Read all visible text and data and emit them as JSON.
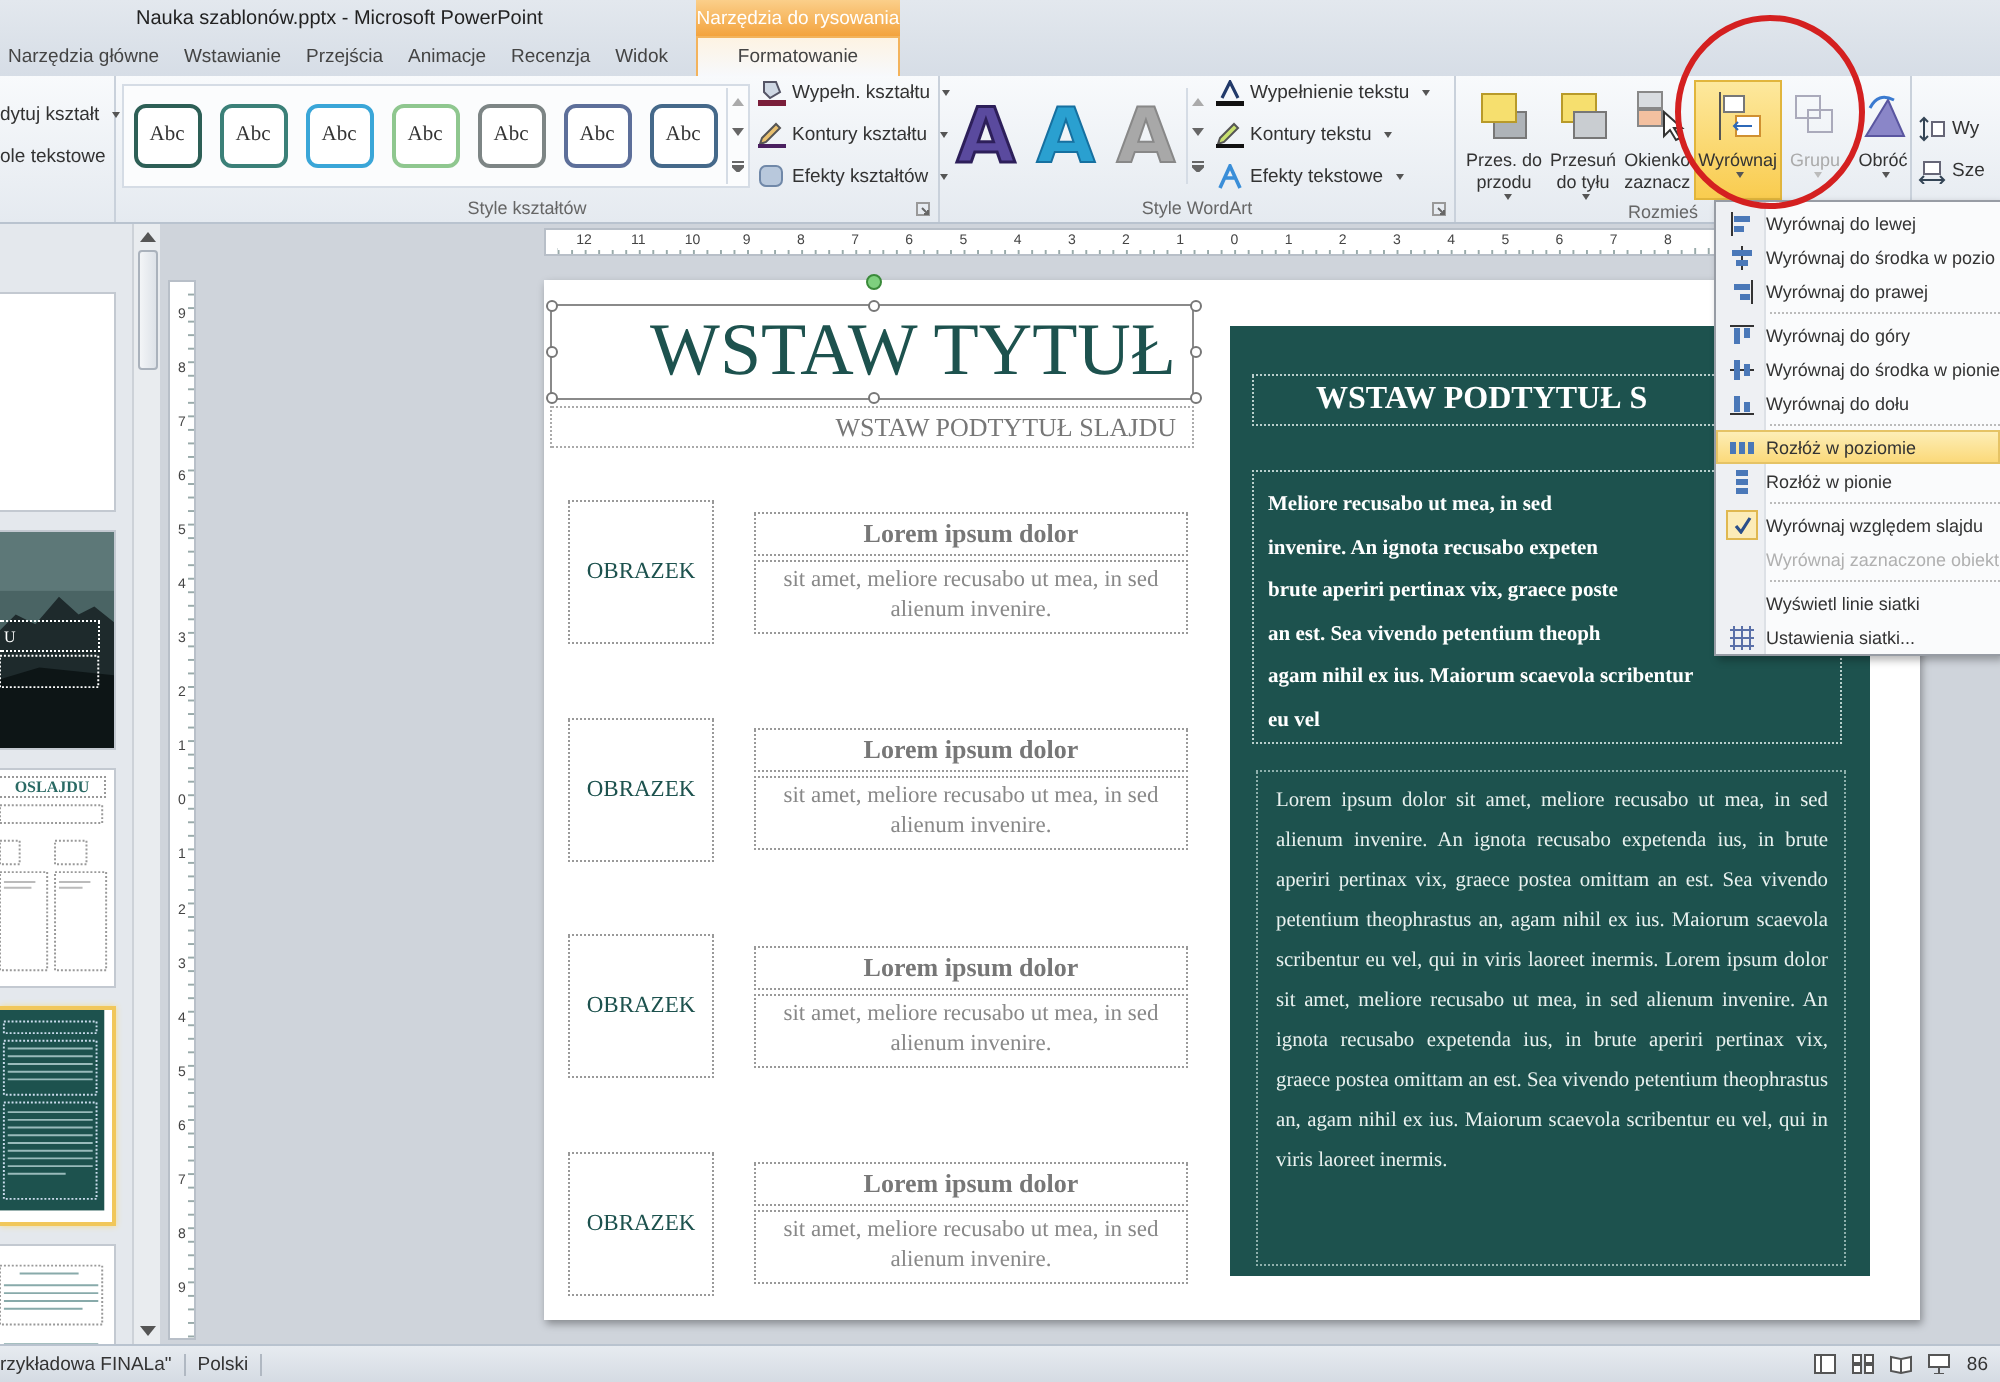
{
  "window": {
    "title": "Nauka szablonów.pptx - Microsoft PowerPoint",
    "context_label": "Narzędzia do rysowania"
  },
  "tabs": [
    {
      "label": "Narzędzia główne",
      "kind": "normal",
      "selected": false
    },
    {
      "label": "Wstawianie",
      "kind": "normal",
      "selected": false
    },
    {
      "label": "Przejścia",
      "kind": "normal",
      "selected": false
    },
    {
      "label": "Animacje",
      "kind": "normal",
      "selected": false
    },
    {
      "label": "Recenzja",
      "kind": "normal",
      "selected": false
    },
    {
      "label": "Widok",
      "kind": "normal",
      "selected": false
    },
    {
      "label": "Formatowanie",
      "kind": "context",
      "selected": true
    }
  ],
  "ribbon": {
    "edit_group": {
      "commands": [
        {
          "label": "dytuj kształt",
          "dropdown": true
        },
        {
          "label": "ole tekstowe",
          "dropdown": false
        }
      ]
    },
    "shape_styles": {
      "title": "Style kształtów",
      "swatches": [
        {
          "label": "Abc",
          "color": "#2d5f56"
        },
        {
          "label": "Abc",
          "color": "#3b8078"
        },
        {
          "label": "Abc",
          "color": "#3aa6d8"
        },
        {
          "label": "Abc",
          "color": "#8fc78f"
        },
        {
          "label": "Abc",
          "color": "#7d8585"
        },
        {
          "label": "Abc",
          "color": "#5d6f9a"
        },
        {
          "label": "Abc",
          "color": "#45698a"
        }
      ],
      "commands": [
        {
          "label": "Wypełn. kształtu",
          "dropdown": true
        },
        {
          "label": "Kontury kształtu",
          "dropdown": true
        },
        {
          "label": "Efekty kształtów",
          "dropdown": true
        }
      ]
    },
    "wordart": {
      "title": "Style WordArt",
      "letters": [
        {
          "label": "A",
          "kind": "filled",
          "color": "#5a4a9e"
        },
        {
          "label": "A",
          "kind": "outline",
          "color": "#2aa0d0"
        },
        {
          "label": "A",
          "kind": "ghost",
          "color": "#a8a8a8"
        }
      ],
      "commands": [
        {
          "label": "Wypełnienie tekstu",
          "dropdown": true
        },
        {
          "label": "Kontury tekstu",
          "dropdown": true
        },
        {
          "label": "Efekty tekstowe",
          "dropdown": true
        }
      ]
    },
    "arrange": {
      "title": "Rozmieś",
      "buttons": [
        {
          "lines": [
            "Przes. do",
            "przodu"
          ],
          "dropdown": true,
          "pressed": false,
          "disabled": false
        },
        {
          "lines": [
            "Przesuń",
            "do tyłu"
          ],
          "dropdown": true,
          "pressed": false,
          "disabled": false
        },
        {
          "lines": [
            "Okienko",
            "zaznacz"
          ],
          "dropdown": false,
          "pressed": false,
          "disabled": false
        },
        {
          "lines": [
            "Wyrównaj"
          ],
          "dropdown": true,
          "pressed": true,
          "disabled": false
        },
        {
          "lines": [
            "Grupu"
          ],
          "dropdown": true,
          "pressed": false,
          "disabled": true
        },
        {
          "lines": [
            "Obróć"
          ],
          "dropdown": true,
          "pressed": false,
          "disabled": false
        }
      ]
    },
    "size_group": {
      "commands": [
        {
          "label": "Wy"
        },
        {
          "label": "Sze"
        }
      ]
    }
  },
  "slides": [
    {
      "kind": "blank",
      "selected": false
    },
    {
      "kind": "picture",
      "caption": "U",
      "selected": false
    },
    {
      "kind": "layout",
      "caption": "OSLAJDU",
      "selected": false
    },
    {
      "kind": "dark",
      "selected": true
    },
    {
      "kind": "text",
      "selected": false
    }
  ],
  "rulers": {
    "horizontal": [
      "12",
      "11",
      "10",
      "9",
      "8",
      "7",
      "6",
      "5",
      "4",
      "3",
      "2",
      "1",
      "0",
      "1",
      "2",
      "3",
      "4",
      "5",
      "6",
      "7",
      "8"
    ],
    "vertical": [
      "9",
      "8",
      "7",
      "6",
      "5",
      "4",
      "3",
      "2",
      "1",
      "0",
      "1",
      "2",
      "3",
      "4",
      "5",
      "6",
      "7",
      "8",
      "9"
    ]
  },
  "slide": {
    "title": "WSTAW TYTUŁ",
    "subtitle": "WSTAW PODTYTUŁ SLAJDU",
    "items": [
      {
        "picture_label": "OBRAZEK",
        "heading": "Lorem ipsum dolor",
        "body": "sit amet, meliore recusabo ut mea, in sed alienum invenire."
      },
      {
        "picture_label": "OBRAZEK",
        "heading": "Lorem ipsum dolor",
        "body": "sit amet, meliore recusabo ut mea, in sed alienum invenire."
      },
      {
        "picture_label": "OBRAZEK",
        "heading": "Lorem ipsum dolor",
        "body": "sit amet, meliore recusabo ut mea, in sed alienum invenire."
      },
      {
        "picture_label": "OBRAZEK",
        "heading": "Lorem ipsum dolor",
        "body": "sit amet, meliore recusabo ut mea, in sed alienum invenire."
      }
    ],
    "panel": {
      "subtitle": "WSTAW PODTYTUŁ S",
      "lead_lines": [
        "Meliore recusabo ut mea, in sed",
        "invenire. An ignota recusabo expeten",
        "brute aperiri pertinax vix, graece poste",
        "an est. Sea vivendo petentium theoph",
        "agam nihil ex ius. Maiorum scaevola scribentur",
        "eu vel"
      ],
      "body": "Lorem ipsum dolor sit amet, meliore recusabo ut mea, in sed alienum invenire. An ignota recusabo expetenda ius, in brute aperiri pertinax vix, graece postea omittam an est. Sea vivendo petentium theophrastus an, agam nihil ex ius. Maiorum scaevola scribentur eu vel, qui in viris laoreet inermis. Lorem ipsum dolor sit amet, meliore recusabo ut mea, in sed alienum invenire. An ignota recusabo expetenda ius, in brute aperiri pertinax vix, graece postea omittam an est. Sea vivendo petentium theophrastus an, agam nihil ex ius. Maiorum scaevola scribentur eu vel, qui in viris laoreet inermis."
    }
  },
  "menu": {
    "items": [
      {
        "kind": "item",
        "label": "Wyrównaj do lewej",
        "highlighted": false,
        "checked": false,
        "disabled": false
      },
      {
        "kind": "item",
        "label": "Wyrównaj do środka w pozio",
        "highlighted": false,
        "checked": false,
        "disabled": false
      },
      {
        "kind": "item",
        "label": "Wyrównaj do prawej",
        "highlighted": false,
        "checked": false,
        "disabled": false
      },
      {
        "kind": "separator"
      },
      {
        "kind": "item",
        "label": "Wyrównaj do góry",
        "highlighted": false,
        "checked": false,
        "disabled": false
      },
      {
        "kind": "item",
        "label": "Wyrównaj do środka w pionie",
        "highlighted": false,
        "checked": false,
        "disabled": false
      },
      {
        "kind": "item",
        "label": "Wyrównaj do dołu",
        "highlighted": false,
        "checked": false,
        "disabled": false
      },
      {
        "kind": "separator"
      },
      {
        "kind": "item",
        "label": "Rozłóż w poziomie",
        "highlighted": true,
        "checked": false,
        "disabled": false
      },
      {
        "kind": "item",
        "label": "Rozłóż w pionie",
        "highlighted": false,
        "checked": false,
        "disabled": false
      },
      {
        "kind": "separator"
      },
      {
        "kind": "item",
        "label": "Wyrównaj względem slajdu",
        "highlighted": false,
        "checked": true,
        "disabled": false
      },
      {
        "kind": "item",
        "label": "Wyrównaj zaznaczone obiekt",
        "highlighted": false,
        "checked": false,
        "disabled": true
      },
      {
        "kind": "separator"
      },
      {
        "kind": "item",
        "label": "Wyświetl linie siatki",
        "highlighted": false,
        "checked": false,
        "disabled": false
      },
      {
        "kind": "item",
        "label": "Ustawienia siatki...",
        "highlighted": false,
        "checked": false,
        "disabled": false
      }
    ]
  },
  "status_bar": {
    "file": "rzykładowa FINALa\"",
    "language": "Polski",
    "zoom": "86"
  }
}
